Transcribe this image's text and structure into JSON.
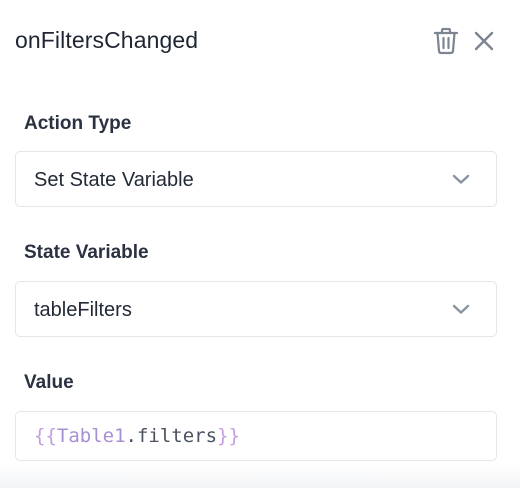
{
  "header": {
    "title": "onFiltersChanged"
  },
  "icons": {
    "delete": "trash-icon",
    "close": "close-icon",
    "dropdown": "chevron-down-icon"
  },
  "fields": {
    "action_type": {
      "label": "Action Type",
      "value": "Set State Variable"
    },
    "state_variable": {
      "label": "State Variable",
      "value": "tableFilters"
    },
    "value": {
      "label": "Value",
      "open_braces": "{{",
      "identifier": "Table1",
      "dot": ".",
      "property": "filters",
      "close_braces": "}}"
    }
  },
  "colors": {
    "text": "#1f2633",
    "border": "#e3e6ea",
    "chevron": "#8a93a0",
    "template_brace": "#c29ee0",
    "template_identifier": "#a88fd2"
  }
}
